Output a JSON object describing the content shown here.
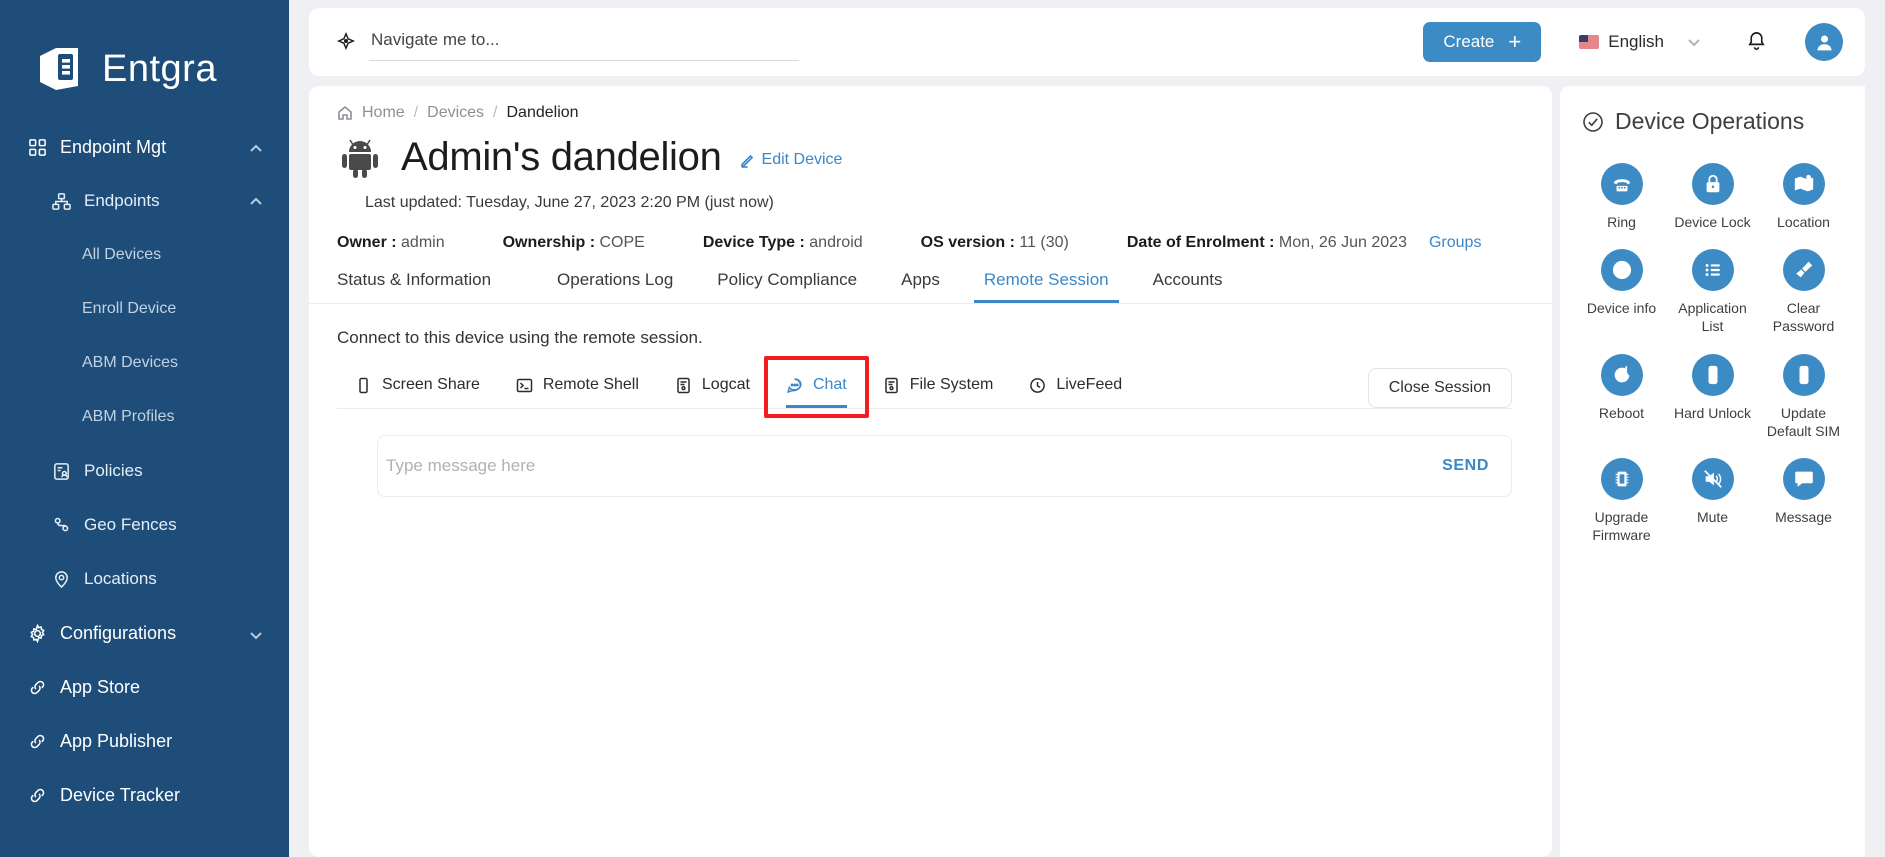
{
  "brand": {
    "name": "Entgra"
  },
  "sidebar": {
    "items": [
      {
        "label": "Endpoint Mgt",
        "level": 0,
        "icon": "grid-icon",
        "chevron": "chevron-up-icon",
        "active": false
      },
      {
        "label": "Endpoints",
        "level": 1,
        "icon": "sitemap-icon",
        "chevron": "chevron-up-icon",
        "active": true
      },
      {
        "label": "All Devices",
        "level": 2,
        "icon": "",
        "chevron": "",
        "active": false
      },
      {
        "label": "Enroll Device",
        "level": 2,
        "icon": "",
        "chevron": "",
        "active": false
      },
      {
        "label": "ABM Devices",
        "level": 2,
        "icon": "",
        "chevron": "",
        "active": false
      },
      {
        "label": "ABM Profiles",
        "level": 2,
        "icon": "",
        "chevron": "",
        "active": false
      },
      {
        "label": "Policies",
        "level": 1,
        "icon": "policy-icon",
        "chevron": "",
        "active": false
      },
      {
        "label": "Geo Fences",
        "level": 1,
        "icon": "geofence-icon",
        "chevron": "",
        "active": false
      },
      {
        "label": "Locations",
        "level": 1,
        "icon": "location-pin-icon",
        "chevron": "",
        "active": false
      },
      {
        "label": "Configurations",
        "level": 0,
        "icon": "gear-icon",
        "chevron": "chevron-down-icon",
        "active": false
      },
      {
        "label": "App Store",
        "level": 0,
        "icon": "link-icon",
        "chevron": "",
        "active": false
      },
      {
        "label": "App Publisher",
        "level": 0,
        "icon": "link-icon",
        "chevron": "",
        "active": false
      },
      {
        "label": "Device Tracker",
        "level": 0,
        "icon": "link-icon",
        "chevron": "",
        "active": false
      }
    ]
  },
  "topbar": {
    "search_placeholder": "Navigate me to...",
    "search_value": "",
    "search_icon": "navigate-pin-icon",
    "create_label": "Create",
    "create_plus": "+",
    "language": "English",
    "language_chevron": "chevron-down-icon",
    "bell_icon": "bell-icon",
    "avatar_icon": "user-avatar-icon"
  },
  "breadcrumb": {
    "home_icon": "home-icon",
    "items": [
      "Home",
      "Devices",
      "Dandelion"
    ],
    "separator": "/"
  },
  "device": {
    "android_icon": "android-robot-icon",
    "title": "Admin's dandelion",
    "edit_label": "Edit Device",
    "edit_icon": "pencil-icon",
    "last_updated": "Last updated: Tuesday, June 27, 2023 2:20 PM (just now)",
    "meta": [
      {
        "label": "Owner :",
        "value": "admin"
      },
      {
        "label": "Ownership :",
        "value": "COPE"
      },
      {
        "label": "Device Type :",
        "value": "android"
      },
      {
        "label": "OS version :",
        "value": "11 (30)"
      },
      {
        "label": "Date of Enrolment :",
        "value": "Mon, 26 Jun 2023"
      }
    ],
    "groups_link": "Groups"
  },
  "tabs": [
    {
      "label": "Status & Information",
      "active": false
    },
    {
      "label": "Operations Log",
      "active": false
    },
    {
      "label": "Policy Compliance",
      "active": false
    },
    {
      "label": "Apps",
      "active": false
    },
    {
      "label": "Remote Session",
      "active": true
    },
    {
      "label": "Accounts",
      "active": false
    }
  ],
  "remote_session": {
    "note": "Connect to this device using the remote session.",
    "subtabs": [
      {
        "label": "Screen Share",
        "icon": "phone-outline-icon",
        "active": false,
        "highlighted": false
      },
      {
        "label": "Remote Shell",
        "icon": "terminal-icon",
        "active": false,
        "highlighted": false
      },
      {
        "label": "Logcat",
        "icon": "logcat-icon",
        "active": false,
        "highlighted": false
      },
      {
        "label": "Chat",
        "icon": "chat-bubble-icon",
        "active": true,
        "highlighted": true
      },
      {
        "label": "File System",
        "icon": "file-system-icon",
        "active": false,
        "highlighted": false
      },
      {
        "label": "LiveFeed",
        "icon": "livefeed-icon",
        "active": false,
        "highlighted": false
      }
    ],
    "close_session_label": "Close Session",
    "chat_placeholder": "Type message here",
    "chat_value": "",
    "send_label": "SEND"
  },
  "device_operations": {
    "title": "Device Operations",
    "title_icon": "check-circle-icon",
    "operations": [
      {
        "label": "Ring",
        "icon": "phone-ring-icon"
      },
      {
        "label": "Device Lock",
        "icon": "lock-icon"
      },
      {
        "label": "Location",
        "icon": "map-icon"
      },
      {
        "label": "Device info",
        "icon": "info-icon"
      },
      {
        "label": "Application List",
        "icon": "list-icon"
      },
      {
        "label": "Clear Password",
        "icon": "broom-icon"
      },
      {
        "label": "Reboot",
        "icon": "refresh-icon"
      },
      {
        "label": "Hard Unlock",
        "icon": "mobile-icon"
      },
      {
        "label": "Update Default SIM",
        "icon": "mobile-icon"
      },
      {
        "label": "Upgrade Firmware",
        "icon": "chip-icon"
      },
      {
        "label": "Mute",
        "icon": "mute-icon"
      },
      {
        "label": "Message",
        "icon": "message-icon"
      }
    ]
  },
  "colors": {
    "sidebar_bg": "#1e4d79",
    "accent_blue": "#3b87c8",
    "op_circle": "#3d8bc4",
    "highlight_red": "#f41d1d",
    "page_bg": "#eef0f4"
  }
}
